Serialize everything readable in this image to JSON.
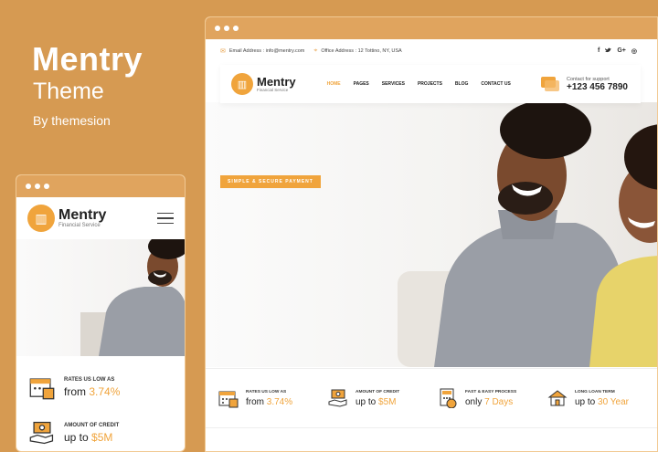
{
  "promo": {
    "title": "Mentry",
    "subtitle": "Theme",
    "byline": "By themesion"
  },
  "topbar": {
    "email": "Email Address : info@mentry.com",
    "office": "Office Address : 12 Tottino, NY, USA",
    "social": [
      "f",
      "✝",
      "G+",
      "◎"
    ]
  },
  "brand": {
    "name": "Mentry",
    "tagline": "Financial Service"
  },
  "nav": [
    "HOME",
    "PAGES",
    "SERVICES",
    "PROJECTS",
    "BLOG",
    "CONTACT US"
  ],
  "support": {
    "label": "Contact for support",
    "phone": "+123 456 7890"
  },
  "hero": {
    "badge": "SIMPLE & SECURE PAYMENT"
  },
  "features": [
    {
      "label": "RATES US LOW AS",
      "prefix": "from ",
      "value": "3.74%"
    },
    {
      "label": "AMOUNT OF CREDIT",
      "prefix": "up to ",
      "value": "$5M"
    },
    {
      "label": "FAST & EASY PROCESS",
      "prefix": "only ",
      "value": "7 Days"
    },
    {
      "label": "LONG LOAN TERM",
      "prefix": "up to ",
      "value": "30 Year"
    }
  ],
  "colors": {
    "background": "#D69A52",
    "accent": "#F0A43C",
    "browser_bar": "#E0A45E"
  }
}
